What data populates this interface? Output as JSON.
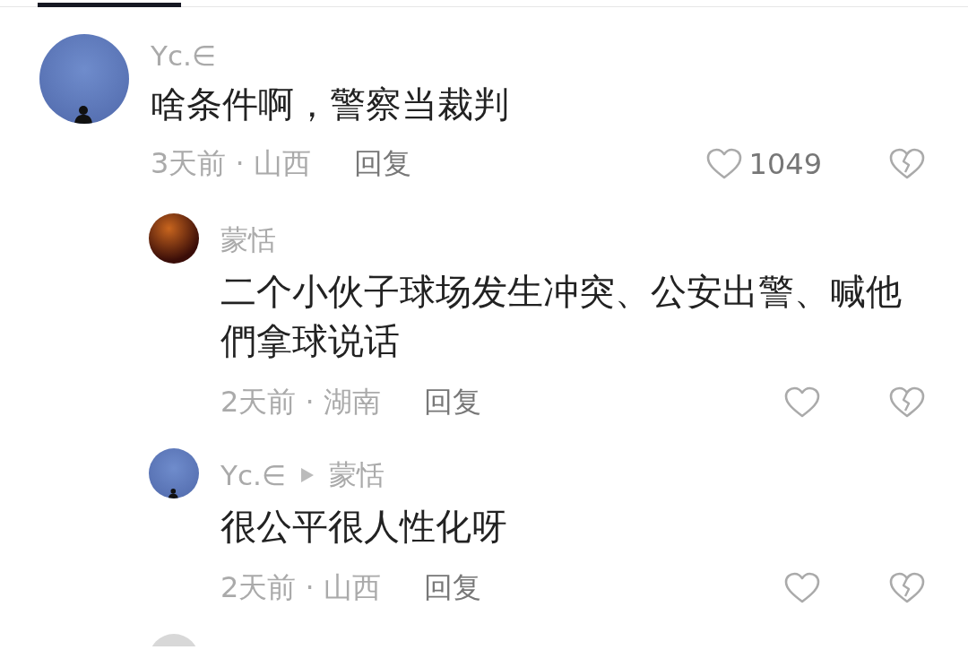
{
  "tab_indicator": {
    "selected": true
  },
  "comments": [
    {
      "author": "Yc.∈",
      "text": "啥条件啊，警察当裁判",
      "time_location": "3天前 · 山西",
      "reply_label": "回复",
      "like_count": "1049",
      "avatar": {
        "kind": "sky"
      },
      "children": [
        {
          "author": "蒙恬",
          "text": "二个小伙子球场发生冲突、公安出警、喊他們拿球说话",
          "time_location": "2天前 · 湖南",
          "reply_label": "回复",
          "avatar": {
            "kind": "ember"
          }
        },
        {
          "author": "Yc.∈",
          "reply_to": "蒙恬",
          "text": "很公平很人性化呀",
          "time_location": "2天前 · 山西",
          "reply_label": "回复",
          "avatar": {
            "kind": "sky"
          }
        }
      ]
    },
    {
      "avatar": {
        "kind": "sketch"
      }
    }
  ]
}
